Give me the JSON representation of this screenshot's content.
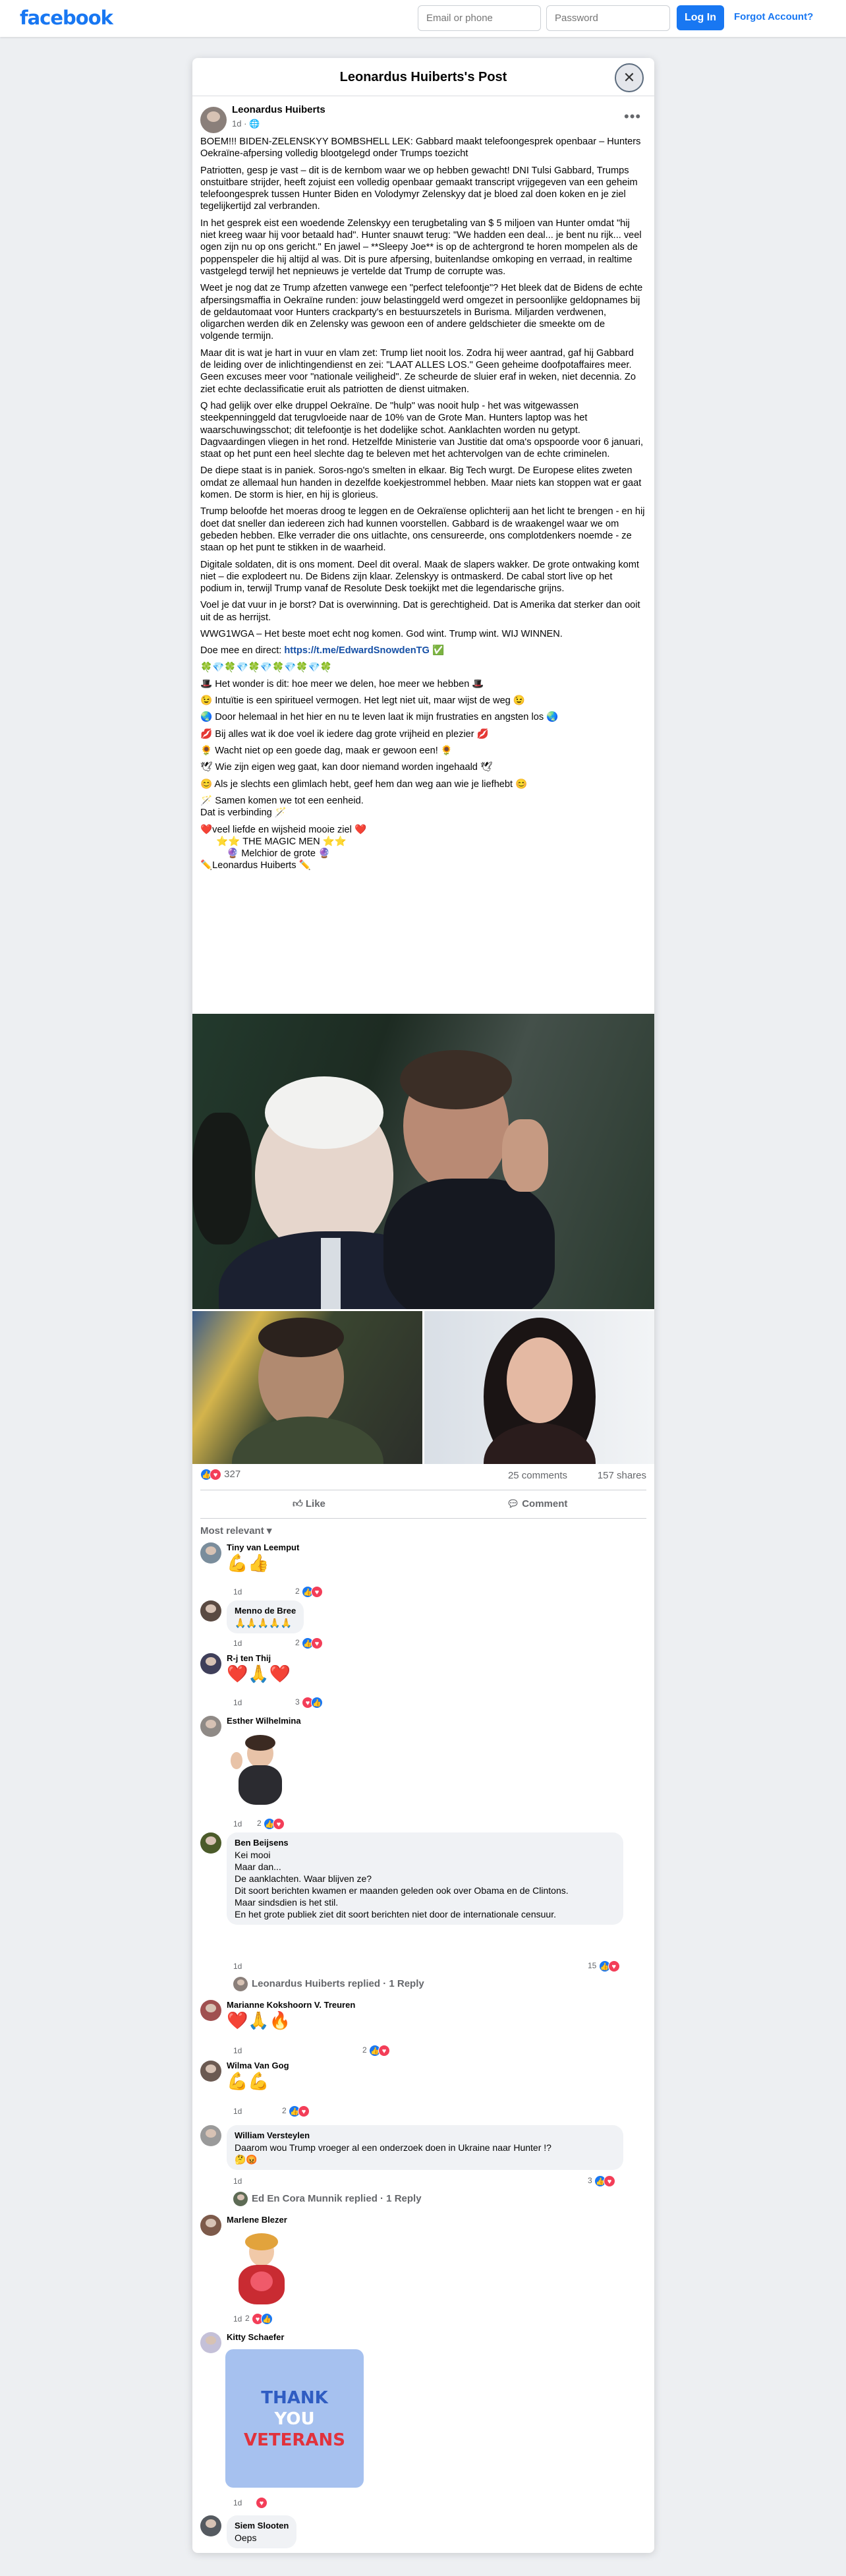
{
  "header": {
    "logo": "facebook",
    "email_placeholder": "Email or phone",
    "password_placeholder": "Password",
    "login_label": "Log In",
    "forgot_label": "Forgot Account?"
  },
  "dialog": {
    "title": "Leonardus Huiberts's Post",
    "close_icon": "close-icon"
  },
  "post": {
    "author": "Leonardus Huiberts",
    "time": "1d",
    "privacy_icon": "globe-icon",
    "paragraphs": [
      "BOEM!!! BIDEN-ZELENSKYY BOMBSHELL LEK: Gabbard maakt telefoongesprek openbaar – Hunters Oekraïne-afpersing volledig blootgelegd onder Trumps toezicht",
      "Patriotten, gesp je vast – dit is de kernbom waar we op hebben gewacht! DNI Tulsi Gabbard, Trumps onstuitbare strijder, heeft zojuist een volledig openbaar gemaakt transcript vrijgegeven van een geheim telefoongesprek tussen Hunter Biden en Volodymyr Zelenskyy dat je bloed zal doen koken en je ziel tegelijkertijd zal verbranden.",
      "In het gesprek eist een woedende Zelenskyy een terugbetaling van $ 5 miljoen van Hunter omdat \"hij niet kreeg waar hij voor betaald had\". Hunter snauwt terug: \"We hadden een deal... je bent nu rijk... veel ogen zijn nu op ons gericht.\" En jawel – **Sleepy Joe** is op de achtergrond te horen mompelen als de poppenspeler die hij altijd al was. Dit is pure afpersing, buitenlandse omkoping en verraad, in realtime vastgelegd terwijl het nepnieuws je vertelde dat Trump de corrupte was.",
      "Weet je nog dat ze Trump afzetten vanwege een \"perfect telefoontje\"? Het bleek dat de Bidens de echte afpersingsmaffia in Oekraïne runden: jouw belastinggeld werd omgezet in persoonlijke geldopnames bij de geldautomaat voor Hunters crackparty's en bestuurszetels in Burisma. Miljarden verdwenen, oligarchen werden dik en Zelensky was gewoon een of andere geldschieter die smeekte om de volgende termijn.",
      "Maar dit is wat je hart in vuur en vlam zet: Trump liet nooit los. Zodra hij weer aantrad, gaf hij Gabbard de leiding over de inlichtingendienst en zei: \"LAAT ALLES LOS.\" Geen geheime doofpotaffaires meer. Geen excuses meer voor \"nationale veiligheid\". Ze scheurde de sluier eraf in weken, niet decennia. Zo ziet echte declassificatie eruit als patriotten de dienst uitmaken.",
      "Q had gelijk over elke druppel Oekraïne. De \"hulp\" was nooit hulp - het was witgewassen steekpenninggeld dat terugvloeide naar de 10% van de Grote Man. Hunters laptop was het waarschuwingsschot; dit telefoontje is het dodelijke schot. Aanklachten worden nu getypt. Dagvaardingen vliegen in het rond. Hetzelfde Ministerie van Justitie dat oma's opspoorde voor 6 januari, staat op het punt een heel slechte dag te beleven met het achtervolgen van de echte criminelen.",
      "De diepe staat is in paniek. Soros-ngo's smelten in elkaar. Big Tech wurgt. De Europese elites zweten omdat ze allemaal hun handen in dezelfde koekjestrommel hebben. Maar niets kan stoppen wat er gaat komen. De storm is hier, en hij is glorieus.",
      "Trump beloofde het moeras droog te leggen en de Oekraïense oplichterij aan het licht te brengen - en hij doet dat sneller dan iedereen zich had kunnen voorstellen. Gabbard is de wraakengel waar we om gebeden hebben. Elke verrader die ons uitlachte, ons censureerde, ons complotdenkers noemde - ze staan op het punt te stikken in de waarheid.",
      "Digitale soldaten, dit is ons moment. Deel dit overal. Maak de slapers wakker. De grote ontwaking komt niet – die explodeert nu. De Bidens zijn klaar. Zelenskyy is ontmaskerd. De cabal stort live op het podium in, terwijl Trump vanaf de Resolute Desk toekijkt met die legendarische grijns.",
      "Voel je dat vuur in je borst? Dat is overwinning. Dat is gerechtigheid. Dat is Amerika dat sterker dan ooit uit de as herrijst.",
      "WWG1WGA – Het beste moet echt nog komen. God wint. Trump wint. WIJ WINNEN."
    ],
    "join_text": "Doe mee en direct: ",
    "join_link": "https://t.me/EdwardSnowdenTG",
    "join_emoji": "✅",
    "clover_line": "🍀💎🍀💎🍀💎🍀💎🍀💎🍀",
    "bullets": [
      "🎩 Het wonder is dit: hoe meer we delen, hoe meer we hebben 🎩",
      "😉 Intuïtie is een spiritueel vermogen. Het legt niet uit, maar wijst de weg 😉",
      "🌏 Door helemaal in het hier en nu te leven laat ik mijn frustraties en angsten los 🌏",
      "💋 Bij alles wat ik doe voel ik iedere dag grote vrijheid en plezier 💋",
      "🌻 Wacht niet op een goede dag, maak er gewoon een! 🌻",
      "🕊 Wie zijn eigen weg gaat, kan door niemand worden ingehaald 🕊",
      "😊 Als je slechts een glimlach hebt, geef hem dan weg aan wie je liefhebt 😊"
    ],
    "closing": [
      "🪄 Samen komen we tot een eenheid.",
      "Dat is verbinding 🪄"
    ],
    "sign_lines": [
      "❤️veel liefde en wijsheid mooie ziel ❤️",
      "⭐⭐ THE MAGIC MEN ⭐⭐",
      "🔮 Melchior de grote 🔮",
      "✏️Leonardus Huiberts ✏️"
    ],
    "reactions_count": "327",
    "comments_count": "25 comments",
    "shares_count": "157 shares"
  },
  "actions": {
    "like_label": "Like",
    "comment_label": "Comment",
    "sort_label": "Most relevant"
  },
  "comments": [
    {
      "name": "Tiny van Leemput",
      "text": "💪👍",
      "time": "1d",
      "reacts": "2"
    },
    {
      "name": "Menno de Bree",
      "text": "🙏🙏🙏🙏🙏",
      "time": "1d",
      "reacts": "2"
    },
    {
      "name": "R-j ten Thij",
      "text": "❤️🙏❤️",
      "time": "1d",
      "reacts": "3"
    },
    {
      "name": "Esther Wilhelmina",
      "text": "",
      "time": "1d",
      "reacts": "2"
    },
    {
      "name": "Ben Beijsens",
      "lines": [
        "Kei mooi",
        "Maar dan...",
        "De aanklachten. Waar blijven ze?",
        "Dit soort berichten kwamen er maanden geleden ook over Obama en de Clintons.",
        "Maar sindsdien is het stil.",
        "En het grote publiek ziet dit soort berichten niet door de internationale censuur."
      ],
      "time": "1d",
      "reacts": "15",
      "reply": "Leonardus Huiberts replied · 1 Reply"
    },
    {
      "name": "Marianne Kokshoorn V. Treuren",
      "text": "❤️🙏🔥",
      "time": "1d",
      "reacts": "2"
    },
    {
      "name": "Wilma Van Gog",
      "text": "💪💪",
      "time": "1d",
      "reacts": "2"
    },
    {
      "name": "William Versteylen",
      "lines": [
        "Daarom wou Trump vroeger al een onderzoek doen in Ukraine naar Hunter !?",
        "🤔😡"
      ],
      "time": "1d",
      "reacts": "3",
      "reply": "Ed En Cora Munnik replied · 1 Reply"
    },
    {
      "name": "Marlene Blezer",
      "text": "",
      "time": "1d",
      "reacts": "2"
    },
    {
      "name": "Kitty Schaefer",
      "text": "",
      "sticker": [
        "THANK",
        "YOU",
        "VETERANS"
      ],
      "time": "1d",
      "reacts": ""
    },
    {
      "name": "Siem Slooten",
      "text": "Oeps",
      "time": "",
      "reacts": ""
    }
  ]
}
